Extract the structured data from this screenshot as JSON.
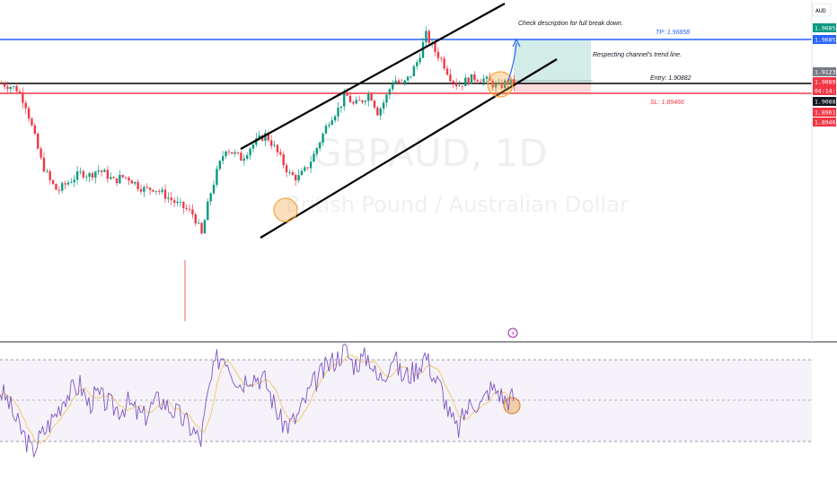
{
  "header": {
    "currency": "AUD"
  },
  "watermark": {
    "symbol": "GBPAUD, 1D",
    "name": "British Pound / Australian Dollar"
  },
  "annotations": {
    "description_note": "Check description for full break down.",
    "trendline_note": "Respecting channel's trend line."
  },
  "levels": {
    "tp_label": "TP: 1.96858",
    "entry_label": "Entry: 1.90882",
    "sl_label": "SL: 1.89466"
  },
  "price_axis": {
    "tags": [
      {
        "text": "1.96858",
        "bg": "#089981",
        "fg": "#ffffff"
      },
      {
        "text": "1.96858",
        "bg": "#2962ff",
        "fg": "#ffffff"
      },
      {
        "text": "1.91239",
        "bg": "#787b86",
        "fg": "#ffffff"
      },
      {
        "text": "1.90892",
        "bg": "#f23645",
        "fg": "#ffffff"
      },
      {
        "text": "04:14:15",
        "bg": "#f23645",
        "fg": "#ffffff"
      },
      {
        "text": "1.90882",
        "bg": "#131722",
        "fg": "#ffffff"
      },
      {
        "text": "1.89610",
        "bg": "#f23645",
        "fg": "#ffffff"
      },
      {
        "text": "1.89466",
        "bg": "#f23645",
        "fg": "#ffffff"
      }
    ]
  },
  "colors": {
    "up": "#089981",
    "down": "#f23645",
    "tp_line": "#2962ff",
    "entry_line": "#000000",
    "sl_line": "#f23645",
    "rsi_line": "#7e57c2",
    "rsi_ma": "#f0c050",
    "highlight": "#f5a742"
  },
  "chart_data": {
    "type": "candlestick",
    "timeframe": "1D",
    "symbol": "GBPAUD",
    "price_range": [
      1.7,
      1.99
    ],
    "levels": {
      "take_profit": 1.96858,
      "entry": 1.90882,
      "stop_loss": 1.89466
    },
    "close_path": [
      1.908,
      1.905,
      1.9,
      1.88,
      1.84,
      1.8,
      1.775,
      1.76,
      1.77,
      1.778,
      1.786,
      1.782,
      1.79,
      1.784,
      1.774,
      1.78,
      1.778,
      1.768,
      1.762,
      1.765,
      1.758,
      1.75,
      1.742,
      1.736,
      1.728,
      1.7,
      1.754,
      1.79,
      1.82,
      1.812,
      1.805,
      1.82,
      1.83,
      1.838,
      1.822,
      1.802,
      1.783,
      1.778,
      1.79,
      1.81,
      1.835,
      1.86,
      1.872,
      1.893,
      1.878,
      1.885,
      1.895,
      1.868,
      1.888,
      1.915,
      1.905,
      1.918,
      1.94,
      1.975,
      1.955,
      1.94,
      1.918,
      1.905,
      1.912,
      1.916,
      1.915,
      1.91,
      1.902,
      1.91,
      1.908
    ],
    "rsi": {
      "overbought": 70,
      "oversold": 30,
      "mid": 50,
      "values": [
        55,
        50,
        40,
        33,
        25,
        32,
        38,
        44,
        52,
        55,
        58,
        48,
        53,
        50,
        47,
        46,
        49,
        44,
        42,
        48,
        51,
        47,
        44,
        40,
        36,
        30,
        55,
        70,
        73,
        64,
        58,
        63,
        62,
        60,
        50,
        40,
        38,
        42,
        50,
        58,
        63,
        68,
        71,
        75,
        68,
        70,
        72,
        60,
        64,
        73,
        62,
        63,
        66,
        73,
        62,
        56,
        43,
        35,
        45,
        50,
        48,
        56,
        55,
        50,
        52
      ]
    }
  }
}
